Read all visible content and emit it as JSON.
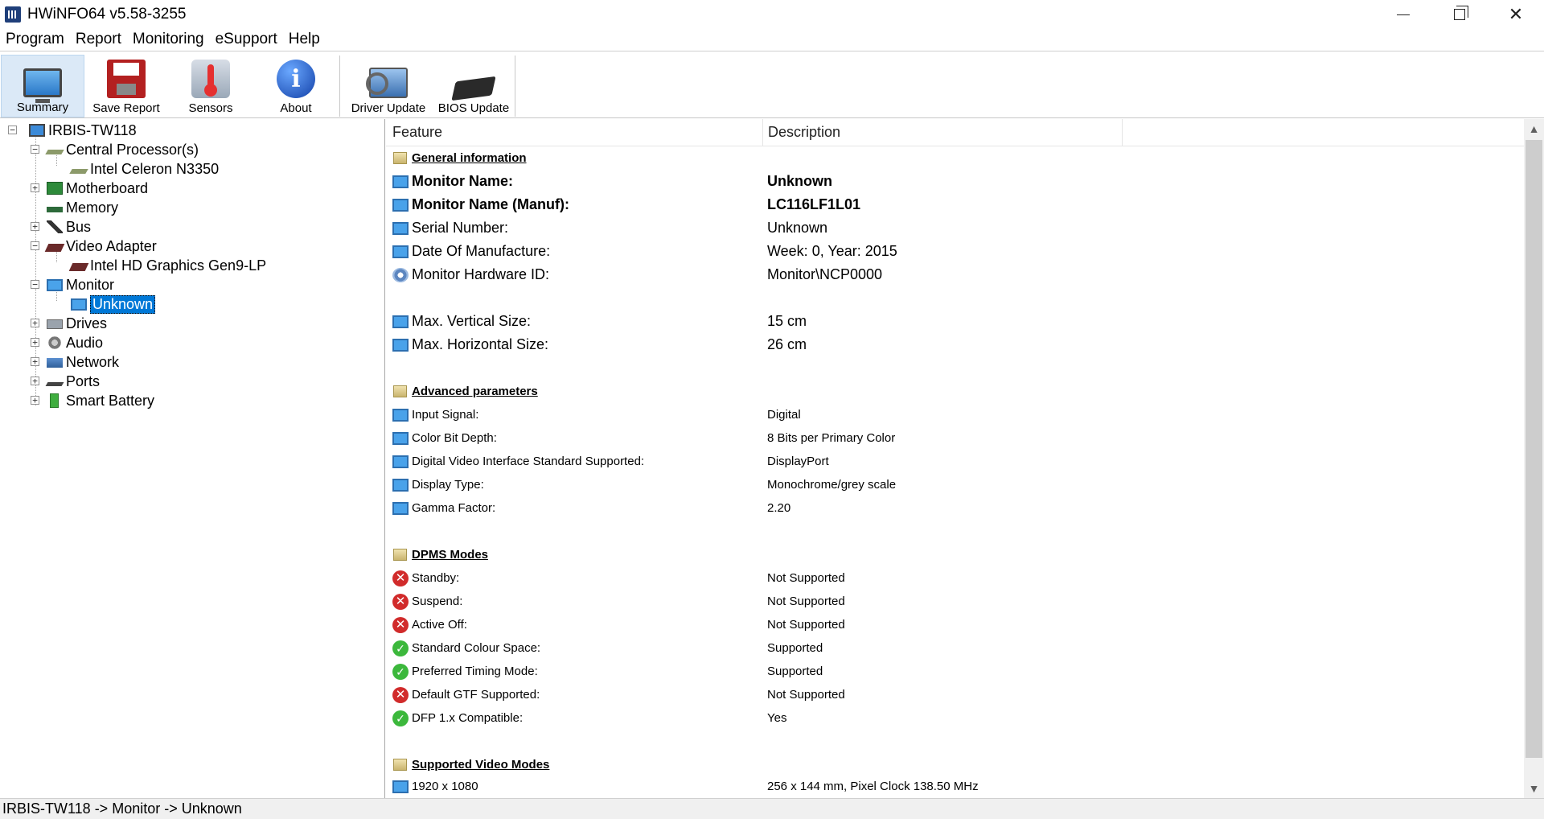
{
  "window": {
    "title": "HWiNFO64 v5.58-3255",
    "icon": "hwinfo-app-icon"
  },
  "menu": [
    "Program",
    "Report",
    "Monitoring",
    "eSupport",
    "Help"
  ],
  "toolbar": {
    "buttons": [
      {
        "label": "Summary",
        "icon": "monitor-icon",
        "active": true
      },
      {
        "label": "Save Report",
        "icon": "floppy-disk-icon"
      },
      {
        "label": "Sensors",
        "icon": "thermometer-icon"
      },
      {
        "label": "About",
        "icon": "info-icon"
      },
      {
        "label": "Driver Update",
        "icon": "driver-update-icon"
      },
      {
        "label": "BIOS Update",
        "icon": "bios-chip-icon"
      }
    ]
  },
  "tree": {
    "root": "IRBIS-TW118",
    "cpu_group": "Central Processor(s)",
    "cpu": "Intel Celeron N3350",
    "motherboard": "Motherboard",
    "memory": "Memory",
    "bus": "Bus",
    "video_group": "Video Adapter",
    "video": "Intel HD Graphics Gen9-LP",
    "monitor_group": "Monitor",
    "monitor": "Unknown",
    "drives": "Drives",
    "audio": "Audio",
    "network": "Network",
    "ports": "Ports",
    "battery": "Smart Battery"
  },
  "list": {
    "columns": [
      "Feature",
      "Description"
    ],
    "sections": {
      "general": "General information",
      "advanced": "Advanced parameters",
      "dpms": "DPMS Modes",
      "video_modes": "Supported Video Modes"
    },
    "general": [
      {
        "feature": "Monitor Name:",
        "value": "Unknown"
      },
      {
        "feature": "Monitor Name (Manuf):",
        "value": "LC116LF1L01"
      },
      {
        "feature": "Serial Number:",
        "value": "Unknown"
      },
      {
        "feature": "Date Of Manufacture:",
        "value": "Week: 0, Year: 2015"
      },
      {
        "feature": "Monitor Hardware ID:",
        "value": "Monitor\\NCP0000"
      }
    ],
    "size": [
      {
        "feature": "Max. Vertical Size:",
        "value": "15 cm"
      },
      {
        "feature": "Max. Horizontal Size:",
        "value": "26 cm"
      }
    ],
    "advanced": [
      {
        "feature": "Input Signal:",
        "value": "Digital"
      },
      {
        "feature": "Color Bit Depth:",
        "value": "8 Bits per Primary Color"
      },
      {
        "feature": "Digital Video Interface Standard Supported:",
        "value": "DisplayPort"
      },
      {
        "feature": "Display Type:",
        "value": "Monochrome/grey scale"
      },
      {
        "feature": "Gamma Factor:",
        "value": "2.20"
      }
    ],
    "dpms": [
      {
        "feature": "Standby:",
        "value": "Not Supported",
        "status": "bad"
      },
      {
        "feature": "Suspend:",
        "value": "Not Supported",
        "status": "bad"
      },
      {
        "feature": "Active Off:",
        "value": "Not Supported",
        "status": "bad"
      },
      {
        "feature": "Standard Colour Space:",
        "value": "Supported",
        "status": "good"
      },
      {
        "feature": "Preferred Timing Mode:",
        "value": "Supported",
        "status": "good"
      },
      {
        "feature": "Default GTF Supported:",
        "value": "Not Supported",
        "status": "bad"
      },
      {
        "feature": "DFP 1.x Compatible:",
        "value": "Yes",
        "status": "good"
      }
    ],
    "video_modes": [
      {
        "feature": "1920 x 1080",
        "value": "256 x 144 mm, Pixel Clock 138.50 MHz"
      }
    ]
  },
  "statusbar": {
    "path": "IRBIS-TW118 -> Monitor -> Unknown"
  },
  "colors": {
    "selection": "#0078d7",
    "toolbar_active": "#dbe9f7",
    "error": "#d12b2b",
    "ok": "#3cb83c"
  }
}
